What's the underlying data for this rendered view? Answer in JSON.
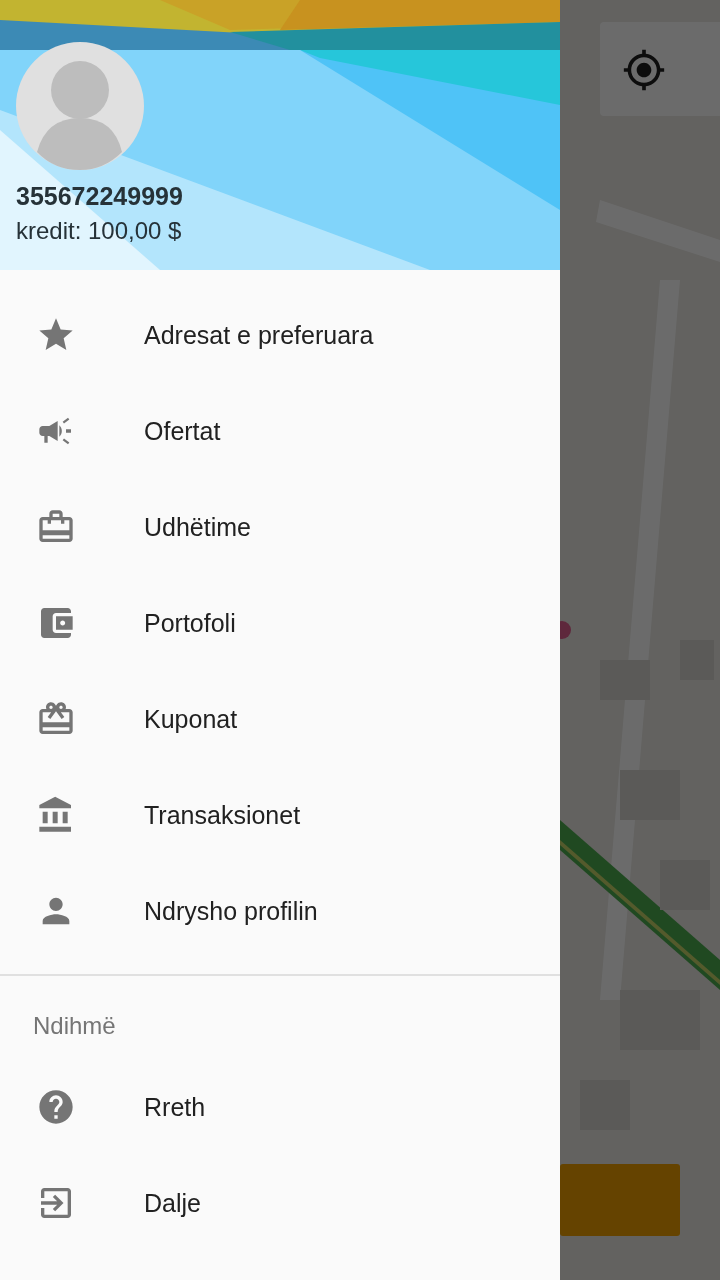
{
  "drawer": {
    "header": {
      "phone": "355672249999",
      "credit": "kredit: 100,00 $"
    },
    "menu": [
      {
        "label": "Adresat e preferuara",
        "kind": "star"
      },
      {
        "label": "Ofertat",
        "kind": "megaphone"
      },
      {
        "label": "Udhëtime",
        "kind": "briefcase"
      },
      {
        "label": "Portofoli",
        "kind": "wallet"
      },
      {
        "label": "Kuponat",
        "kind": "gift"
      },
      {
        "label": "Transaksionet",
        "kind": "bank"
      },
      {
        "label": "Ndrysho profilin",
        "kind": "person"
      }
    ],
    "help_section": {
      "title": "Ndihmë",
      "items": [
        {
          "label": "Rreth",
          "kind": "help"
        },
        {
          "label": "Dalje",
          "kind": "exit"
        }
      ]
    }
  }
}
